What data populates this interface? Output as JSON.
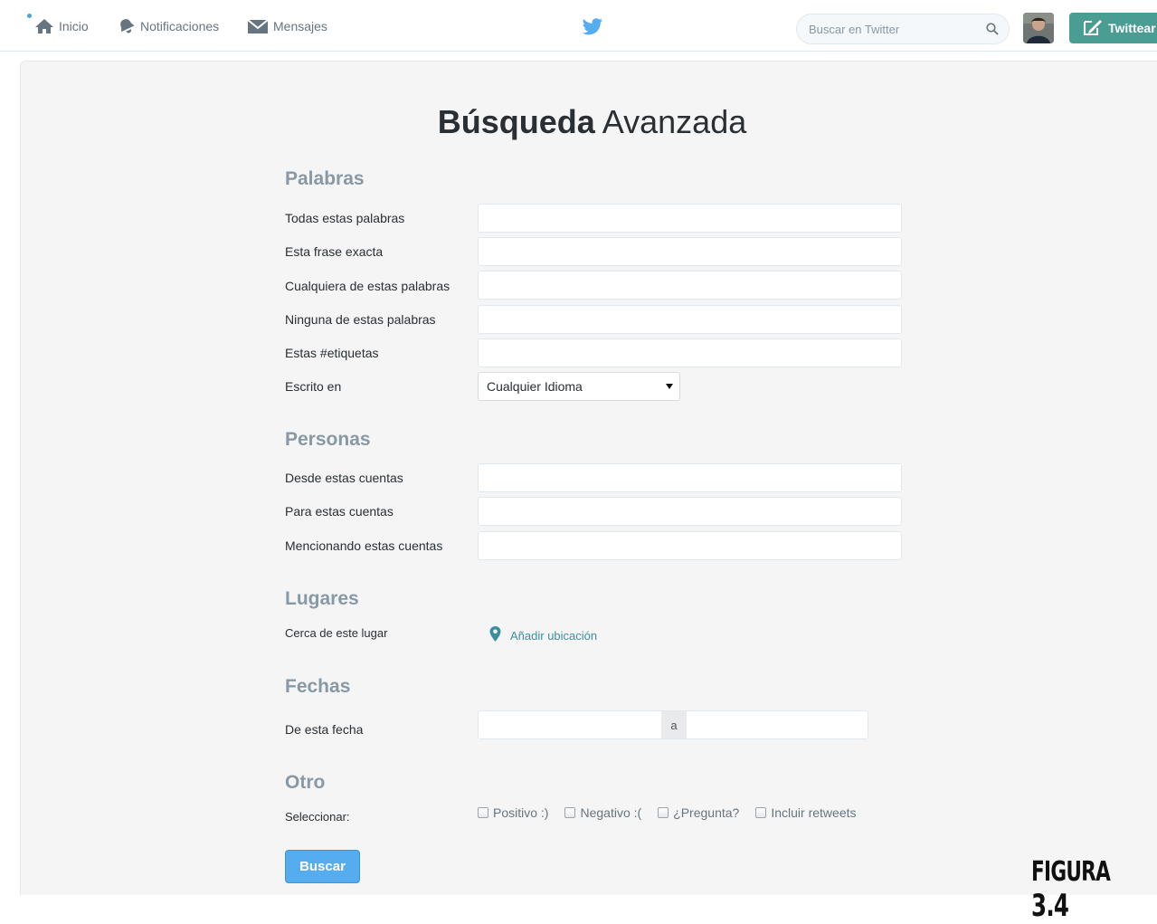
{
  "nav": {
    "home": "Inicio",
    "notifications": "Notificaciones",
    "messages": "Mensajes",
    "search_placeholder": "Buscar en Twitter",
    "tweet_button": "Twittear"
  },
  "page": {
    "title_bold": "Búsqueda",
    "title_rest": "Avanzada"
  },
  "sections": {
    "words": {
      "heading": "Palabras",
      "all_words": "Todas estas palabras",
      "exact_phrase": "Esta frase exacta",
      "any_words": "Cualquiera de estas palabras",
      "none_words": "Ninguna de estas palabras",
      "hashtags": "Estas #etiquetas",
      "language_label": "Escrito en",
      "language_value": "Cualquier Idioma"
    },
    "people": {
      "heading": "Personas",
      "from_accounts": "Desde estas cuentas",
      "to_accounts": "Para estas cuentas",
      "mentioning_accounts": "Mencionando estas cuentas"
    },
    "places": {
      "heading": "Lugares",
      "near_label": "Cerca de este lugar",
      "add_location": "Añadir ubicación"
    },
    "dates": {
      "heading": "Fechas",
      "from_date_label": "De esta fecha",
      "separator": "a"
    },
    "other": {
      "heading": "Otro",
      "select_label": "Seleccionar:",
      "positive": "Positivo :)",
      "negative": "Negativo :(",
      "question": "¿Pregunta?",
      "retweets": "Incluir retweets"
    }
  },
  "actions": {
    "search_button": "Buscar"
  },
  "caption": {
    "figure_word": "Figura",
    "figure_number": "3.4"
  },
  "colors": {
    "accent_blue": "#55acee",
    "tweet_button": "#4a9d93",
    "section_heading": "#8899a6",
    "link": "#3b8fa0"
  },
  "icons": [
    "home-icon",
    "bell-icon",
    "envelope-icon",
    "twitter-bird-icon",
    "search-icon",
    "compose-icon",
    "location-pin-icon"
  ]
}
